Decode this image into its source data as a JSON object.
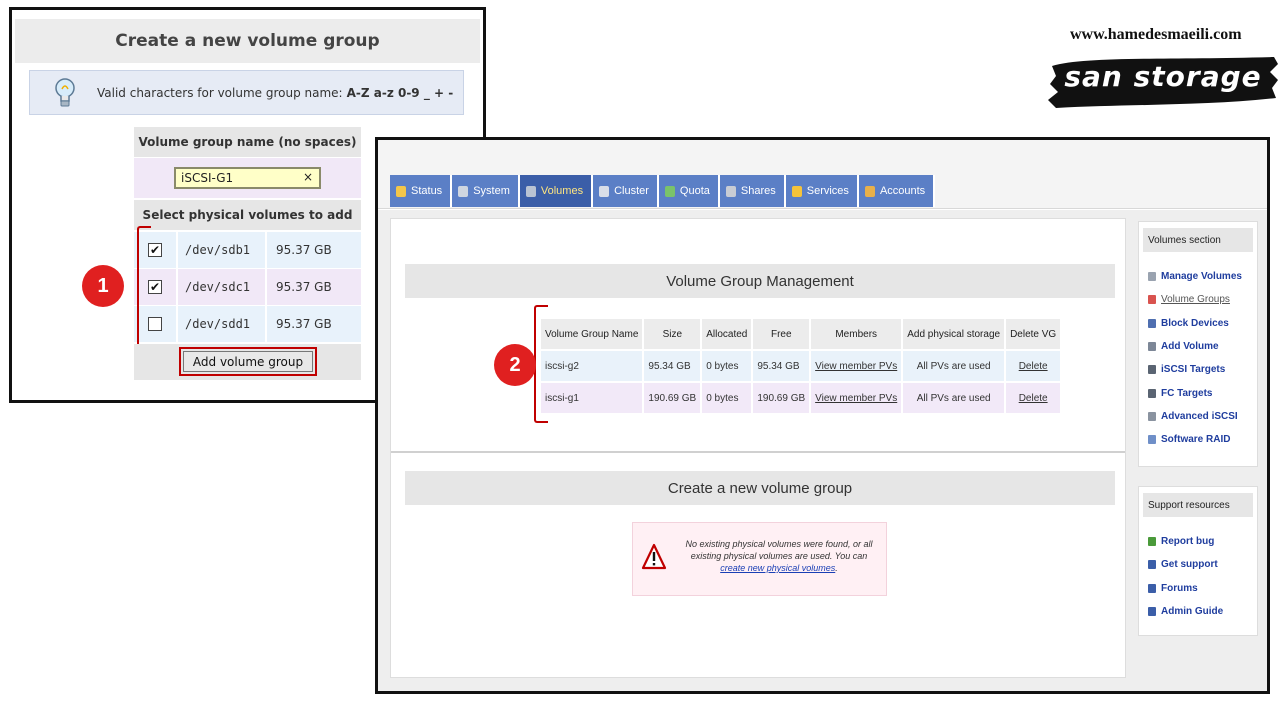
{
  "panel1": {
    "title": "Create a new volume group",
    "info_text": "Valid characters for volume group name:",
    "info_chars": "A-Z a-z 0-9 _ + -",
    "name_label": "Volume group name (no spaces)",
    "name_value": "iSCSI-G1",
    "clear_glyph": "×",
    "pv_label": "Select physical volumes to add",
    "rows": [
      {
        "device": "/dev/sdb1",
        "size": "95.37 GB",
        "checked": true
      },
      {
        "device": "/dev/sdc1",
        "size": "95.37 GB",
        "checked": true
      },
      {
        "device": "/dev/sdd1",
        "size": "95.37 GB",
        "checked": false
      }
    ],
    "button_label": "Add volume group",
    "badge": "1"
  },
  "branding": {
    "url": "www.hamedesmaeili.com",
    "logo_text": "san storage"
  },
  "panel2": {
    "tabs": [
      {
        "label": "Status",
        "icon": "status-icon",
        "color": "#f3c64a"
      },
      {
        "label": "System",
        "icon": "system-icon",
        "color": "#cfd6e0"
      },
      {
        "label": "Volumes",
        "icon": "volumes-icon",
        "color": "#b9c3d3"
      },
      {
        "label": "Cluster",
        "icon": "cluster-icon",
        "color": "#d9dee8"
      },
      {
        "label": "Quota",
        "icon": "quota-icon",
        "color": "#7ac36a"
      },
      {
        "label": "Shares",
        "icon": "shares-icon",
        "color": "#c8ccd4"
      },
      {
        "label": "Services",
        "icon": "services-icon",
        "color": "#f5c33b"
      },
      {
        "label": "Accounts",
        "icon": "accounts-icon",
        "color": "#e8b04a"
      }
    ],
    "active_tab": "Volumes",
    "section1_title": "Volume Group Management",
    "table": {
      "headers": [
        "Volume Group Name",
        "Size",
        "Allocated",
        "Free",
        "Members",
        "Add physical storage",
        "Delete VG"
      ],
      "rows": [
        [
          "iscsi-g2",
          "95.34 GB",
          "0 bytes",
          "95.34 GB",
          "View member PVs",
          "All PVs are used",
          "Delete"
        ],
        [
          "iscsi-g1",
          "190.69 GB",
          "0 bytes",
          "190.69 GB",
          "View member PVs",
          "All PVs are used",
          "Delete"
        ]
      ]
    },
    "badge": "2",
    "section2_title": "Create a new volume group",
    "warning": {
      "text_before": "No existing physical volumes were found, or all existing physical volumes are used. You can",
      "link": "create new physical volumes",
      "text_after": "."
    },
    "sidebar": {
      "volumes_title": "Volumes section",
      "volumes_items": [
        {
          "label": "Manage Volumes",
          "icon": "manage-volumes-icon",
          "color": "#9aa3b0"
        },
        {
          "label": "Volume Groups",
          "icon": "volume-groups-icon",
          "color": "#d9534f"
        },
        {
          "label": "Block Devices",
          "icon": "block-devices-icon",
          "color": "#4f6fb0"
        },
        {
          "label": "Add Volume",
          "icon": "add-volume-icon",
          "color": "#7d8797"
        },
        {
          "label": "iSCSI Targets",
          "icon": "iscsi-targets-icon",
          "color": "#5a6472"
        },
        {
          "label": "FC Targets",
          "icon": "fc-targets-icon",
          "color": "#5a6472"
        },
        {
          "label": "Advanced iSCSI",
          "icon": "advanced-iscsi-icon",
          "color": "#8a93a0"
        },
        {
          "label": "Software RAID",
          "icon": "software-raid-icon",
          "color": "#6f8fc8"
        }
      ],
      "current": "Volume Groups",
      "support_title": "Support resources",
      "support_items": [
        {
          "label": "Report bug",
          "icon": "report-bug-icon",
          "color": "#4a9a3a"
        },
        {
          "label": "Get support",
          "icon": "get-support-icon",
          "color": "#3b5ea8"
        },
        {
          "label": "Forums",
          "icon": "forums-icon",
          "color": "#3b5ea8"
        },
        {
          "label": "Admin Guide",
          "icon": "admin-guide-icon",
          "color": "#3b5ea8"
        }
      ]
    }
  },
  "colors": {
    "accent_red": "#c00000",
    "badge_red": "#e02020",
    "tab_blue": "#5b7fc6",
    "tab_active": "#3b5ea8",
    "link_blue": "#1a3fb5"
  }
}
